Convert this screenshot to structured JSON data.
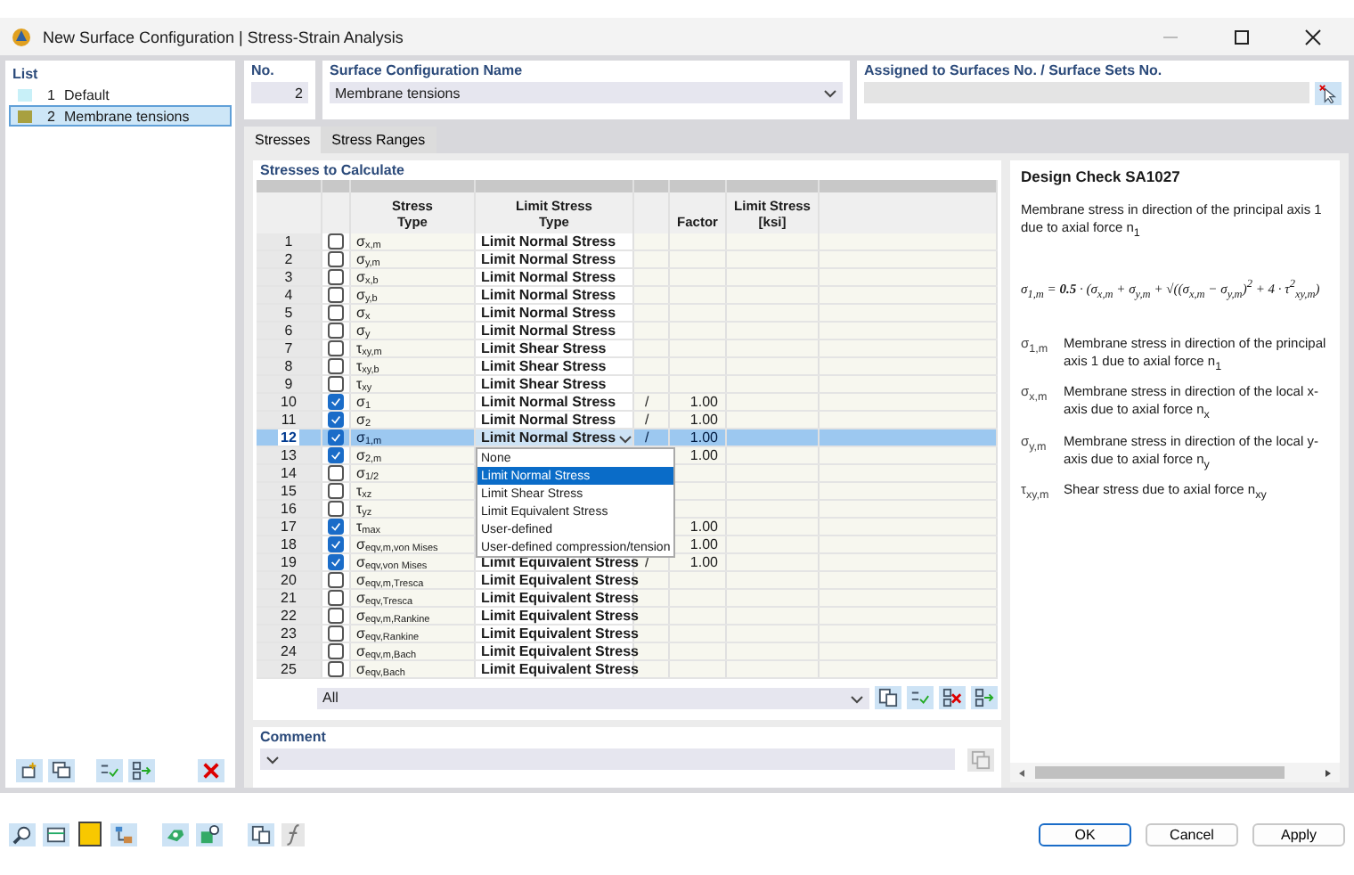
{
  "window": {
    "title": "New Surface Configuration | Stress-Strain Analysis"
  },
  "list": {
    "title": "List",
    "items": [
      {
        "no": "1",
        "name": "Default",
        "color": "#c8f0f8",
        "selected": false
      },
      {
        "no": "2",
        "name": "Membrane tensions",
        "color": "#a8a040",
        "selected": true
      }
    ]
  },
  "no": {
    "label": "No.",
    "value": "2"
  },
  "name": {
    "label": "Surface Configuration Name",
    "value": "Membrane tensions"
  },
  "assigned": {
    "label": "Assigned to Surfaces No. / Surface Sets No."
  },
  "tabs": [
    {
      "label": "Stresses",
      "selected": true
    },
    {
      "label": "Stress Ranges",
      "selected": false
    }
  ],
  "stresses": {
    "title": "Stresses to Calculate",
    "columns": [
      "Stress\nType",
      "Limit Stress\nType",
      "Factor",
      "Limit Stress\n[ksi]"
    ],
    "rows": [
      {
        "no": "1",
        "checked": false,
        "selected": false,
        "stress": "σ$_{x,m}$",
        "limit": "Limit Normal Stress"
      },
      {
        "no": "2",
        "checked": false,
        "selected": false,
        "stress": "σ$_{y,m}$",
        "limit": "Limit Normal Stress"
      },
      {
        "no": "3",
        "checked": false,
        "selected": false,
        "stress": "σ$_{x,b}$",
        "limit": "Limit Normal Stress"
      },
      {
        "no": "4",
        "checked": false,
        "selected": false,
        "stress": "σ$_{y,b}$",
        "limit": "Limit Normal Stress"
      },
      {
        "no": "5",
        "checked": false,
        "selected": false,
        "stress": "σ$_{x}$",
        "limit": "Limit Normal Stress"
      },
      {
        "no": "6",
        "checked": false,
        "selected": false,
        "stress": "σ$_{y}$",
        "limit": "Limit Normal Stress"
      },
      {
        "no": "7",
        "checked": false,
        "selected": false,
        "stress": "τ$_{xy,m}$",
        "limit": "Limit Shear Stress"
      },
      {
        "no": "8",
        "checked": false,
        "selected": false,
        "stress": "τ$_{xy,b}$",
        "limit": "Limit Shear Stress"
      },
      {
        "no": "9",
        "checked": false,
        "selected": false,
        "stress": "τ$_{xy}$",
        "limit": "Limit Shear Stress"
      },
      {
        "no": "10",
        "checked": true,
        "selected": false,
        "stress": "σ$_{1}$",
        "limit": "Limit Normal Stress",
        "column_5": "/",
        "factor": "1.00"
      },
      {
        "no": "11",
        "checked": true,
        "selected": false,
        "stress": "σ$_{2}$",
        "limit": "Limit Normal Stress",
        "column_5": "/",
        "factor": "1.00"
      },
      {
        "no": "12",
        "checked": true,
        "selected": true,
        "stress": "σ$_{1,m}$",
        "limit": "Limit Normal Stress",
        "column_5": "/",
        "factor": "1.00"
      },
      {
        "no": "13",
        "checked": true,
        "selected": false,
        "stress": "σ$_{2,m}$",
        "factor": "1.00"
      },
      {
        "no": "14",
        "checked": false,
        "selected": false,
        "stress": "σ$_{1/2}$"
      },
      {
        "no": "15",
        "checked": false,
        "selected": false,
        "stress": "τ$_{xz}$"
      },
      {
        "no": "16",
        "checked": false,
        "selected": false,
        "stress": "τ$_{yz}$"
      },
      {
        "no": "17",
        "checked": true,
        "selected": false,
        "stress": "τ$_{max}$",
        "factor": "1.00"
      },
      {
        "no": "18",
        "checked": true,
        "selected": false,
        "stress": "σ$_{eqv,m,von Mises}$",
        "factor": "1.00"
      },
      {
        "no": "19",
        "checked": true,
        "selected": false,
        "stress": "σ$_{eqv,von Mises}$",
        "limit": "Limit Equivalent Stress",
        "column_5": "/",
        "factor": "1.00"
      },
      {
        "no": "20",
        "checked": false,
        "selected": false,
        "stress": "σ$_{eqv,m,Tresca}$",
        "limit": "Limit Equivalent Stress"
      },
      {
        "no": "21",
        "checked": false,
        "selected": false,
        "stress": "σ$_{eqv,Tresca}$",
        "limit": "Limit Equivalent Stress"
      },
      {
        "no": "22",
        "checked": false,
        "selected": false,
        "stress": "σ$_{eqv,m,Rankine}$",
        "limit": "Limit Equivalent Stress"
      },
      {
        "no": "23",
        "checked": false,
        "selected": false,
        "stress": "σ$_{eqv,Rankine}$",
        "limit": "Limit Equivalent Stress"
      },
      {
        "no": "24",
        "checked": false,
        "selected": false,
        "stress": "σ$_{eqv,m,Bach}$",
        "limit": "Limit Equivalent Stress"
      },
      {
        "no": "25",
        "checked": false,
        "selected": false,
        "stress": "σ$_{eqv,Bach}$",
        "limit": "Limit Equivalent Stress"
      }
    ],
    "dropdown": [
      {
        "label": "None",
        "selected": false
      },
      {
        "label": "Limit Normal Stress",
        "selected": true
      },
      {
        "label": "Limit Shear Stress",
        "selected": false
      },
      {
        "label": "Limit Equivalent Stress",
        "selected": false
      },
      {
        "label": "User-defined",
        "selected": false
      },
      {
        "label": "User-defined compression/tension",
        "selected": false
      }
    ],
    "filter": "All"
  },
  "comment": {
    "label": "Comment"
  },
  "design_check": {
    "title": "Design Check SA1027",
    "description": "Membrane stress in direction of the principal axis 1 due to axial force n$_{1}$",
    "formula": "σ$_{1,m}$ = **0.5** · (σ$_{x,m}$ + σ$_{y,m}$ + √((σ$_{x,m}$ − σ$_{y,m}$)$^{2}$ + 4 · τ$^{2}$$_{xy,m}$)",
    "legend": [
      {
        "symbol": "σ$_{1,m}$",
        "text": "Membrane stress in direction of the principal axis 1 due to axial force n$_{1}$"
      },
      {
        "symbol": "σ$_{x,m}$",
        "text": "Membrane stress in direction of the local x-axis due to axial force n$_{x}$"
      },
      {
        "symbol": "σ$_{y,m}$",
        "text": "Membrane stress in direction of the local y-axis due to axial force n$_{y}$"
      },
      {
        "symbol": "τ$_{xy,m}$",
        "text": "Shear stress due to axial force n$_{xy}$"
      }
    ]
  },
  "buttons": [
    {
      "label": "OK",
      "default": true
    },
    {
      "label": "Cancel",
      "default": false
    },
    {
      "label": "Apply",
      "default": false
    }
  ]
}
